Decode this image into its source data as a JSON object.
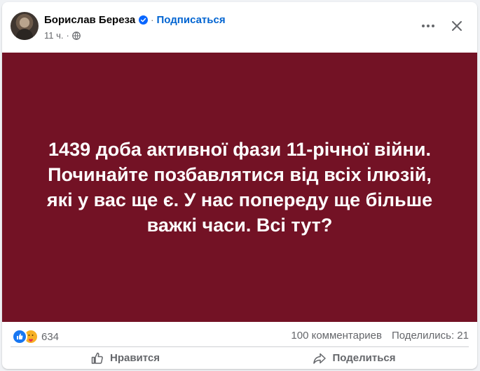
{
  "header": {
    "author": "Борислав Береза",
    "separator": "·",
    "subscribe_label": "Подписаться",
    "time": "11 ч.",
    "meta_separator": "·"
  },
  "post": {
    "text": "1439 доба активної фази 11-річної війни.\nПочинайте позбавлятися від всіх ілюзій,\nякі у вас ще є. У нас попереду ще більше\nважкі часи. Всі тут?",
    "background_color": "#731225",
    "text_color": "#ffffff"
  },
  "stats": {
    "reactions_count": "634",
    "comments": "100 комментариев",
    "shares": "Поделились: 21"
  },
  "actions": {
    "like_label": "Нравится",
    "share_label": "Поделиться"
  },
  "icons": [
    "verified-badge-icon",
    "globe-icon",
    "more-icon",
    "close-icon",
    "like-reaction-icon",
    "care-reaction-icon",
    "thumbs-up-icon",
    "share-arrow-icon"
  ],
  "colors": {
    "link": "#0064d1",
    "secondary_text": "#65676b",
    "like_blue": "#1877f2"
  }
}
